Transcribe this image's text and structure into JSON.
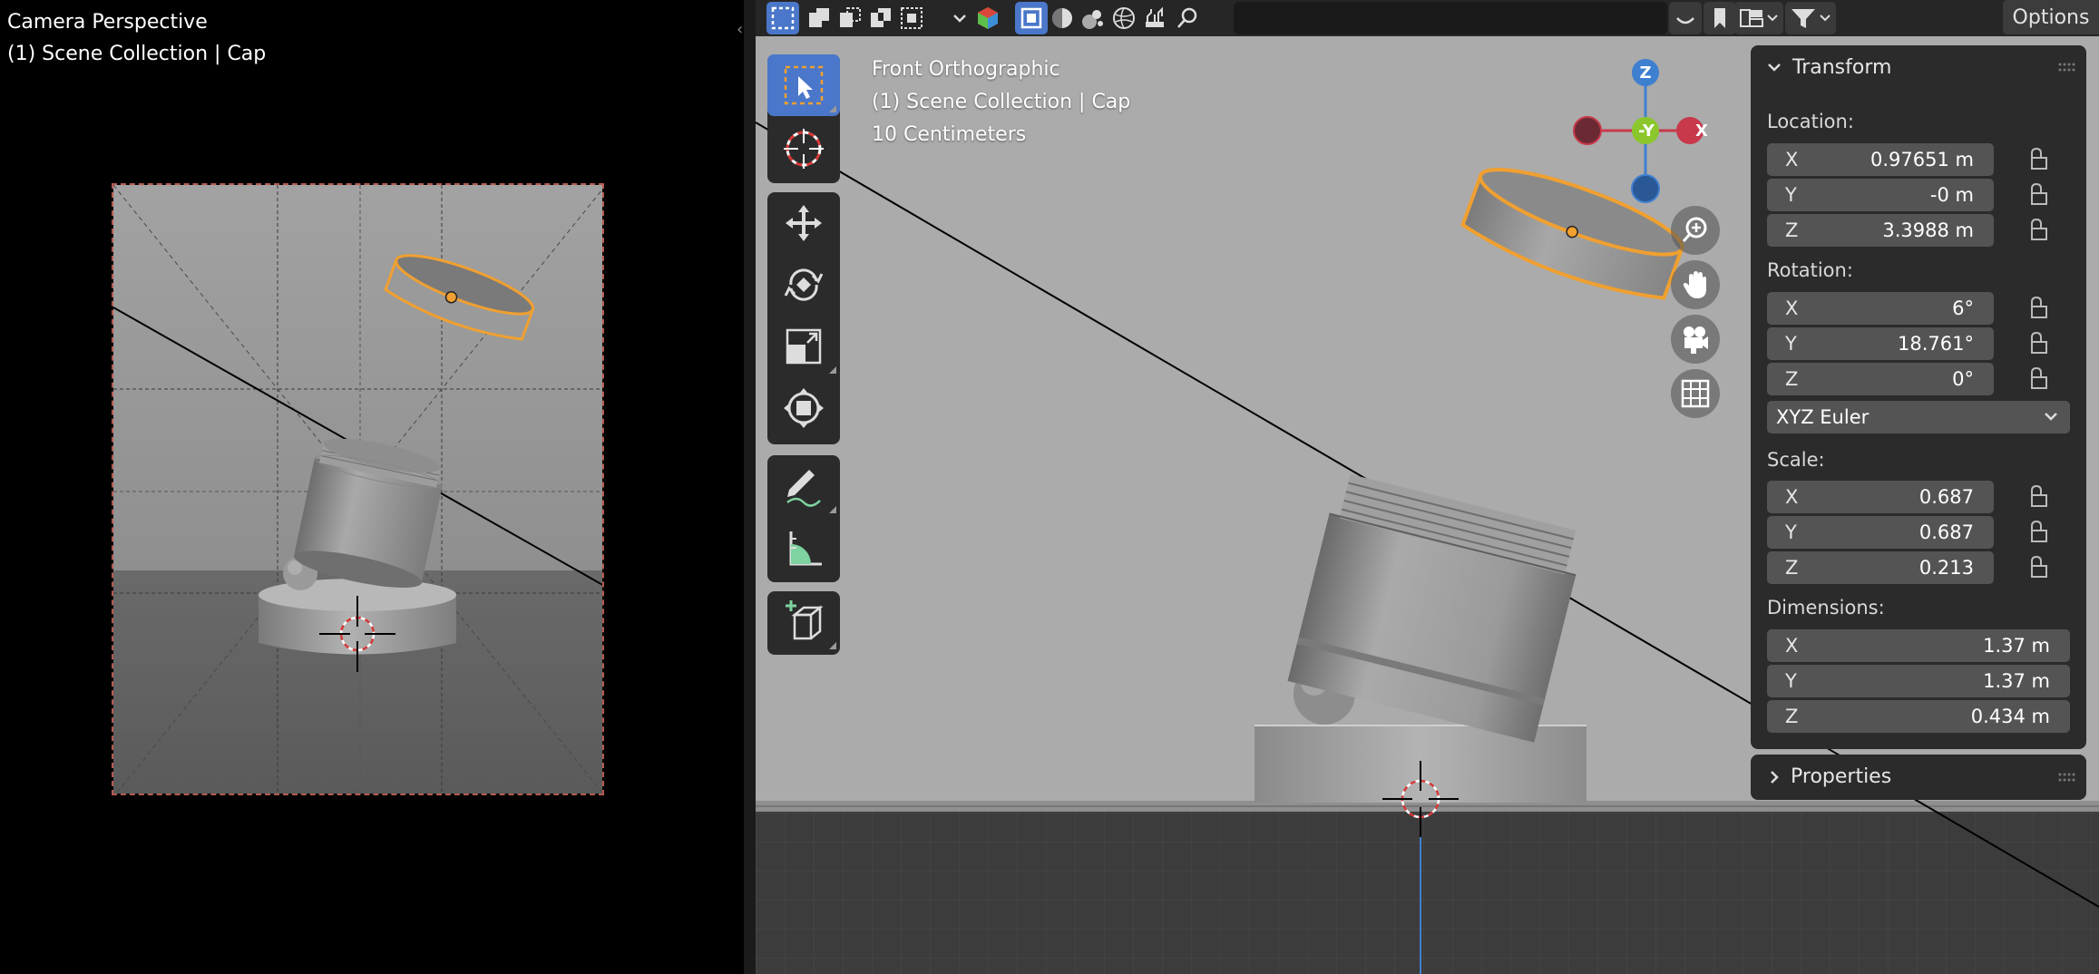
{
  "camera_view": {
    "title": "Camera Perspective",
    "collection": "(1) Scene Collection | Cap"
  },
  "header": {
    "search_placeholder": "",
    "options_label": "Options"
  },
  "viewport": {
    "view_name": "Front Orthographic",
    "collection": "(1) Scene Collection | Cap",
    "grid_scale": "10 Centimeters"
  },
  "gizmo": {
    "z_label": "Z",
    "neg_y_label": "-Y",
    "x_label": "X"
  },
  "transform_panel": {
    "title": "Transform",
    "location_label": "Location:",
    "location": [
      {
        "axis": "X",
        "value": "0.97651 m"
      },
      {
        "axis": "Y",
        "value": "-0 m"
      },
      {
        "axis": "Z",
        "value": "3.3988 m"
      }
    ],
    "rotation_label": "Rotation:",
    "rotation": [
      {
        "axis": "X",
        "value": "6°"
      },
      {
        "axis": "Y",
        "value": "18.761°"
      },
      {
        "axis": "Z",
        "value": "0°"
      }
    ],
    "rotation_mode": "XYZ Euler",
    "scale_label": "Scale:",
    "scale": [
      {
        "axis": "X",
        "value": "0.687"
      },
      {
        "axis": "Y",
        "value": "0.687"
      },
      {
        "axis": "Z",
        "value": "0.213"
      }
    ],
    "dimensions_label": "Dimensions:",
    "dimensions": [
      {
        "axis": "X",
        "value": "1.37 m"
      },
      {
        "axis": "Y",
        "value": "1.37 m"
      },
      {
        "axis": "Z",
        "value": "0.434 m"
      }
    ]
  },
  "properties_panel": {
    "title": "Properties"
  },
  "colors": {
    "accent": "#4a77c9",
    "selection": "#f0a030",
    "axis_x": "#c8394b",
    "axis_y": "#8bc72c",
    "axis_z": "#3f7fd0"
  }
}
